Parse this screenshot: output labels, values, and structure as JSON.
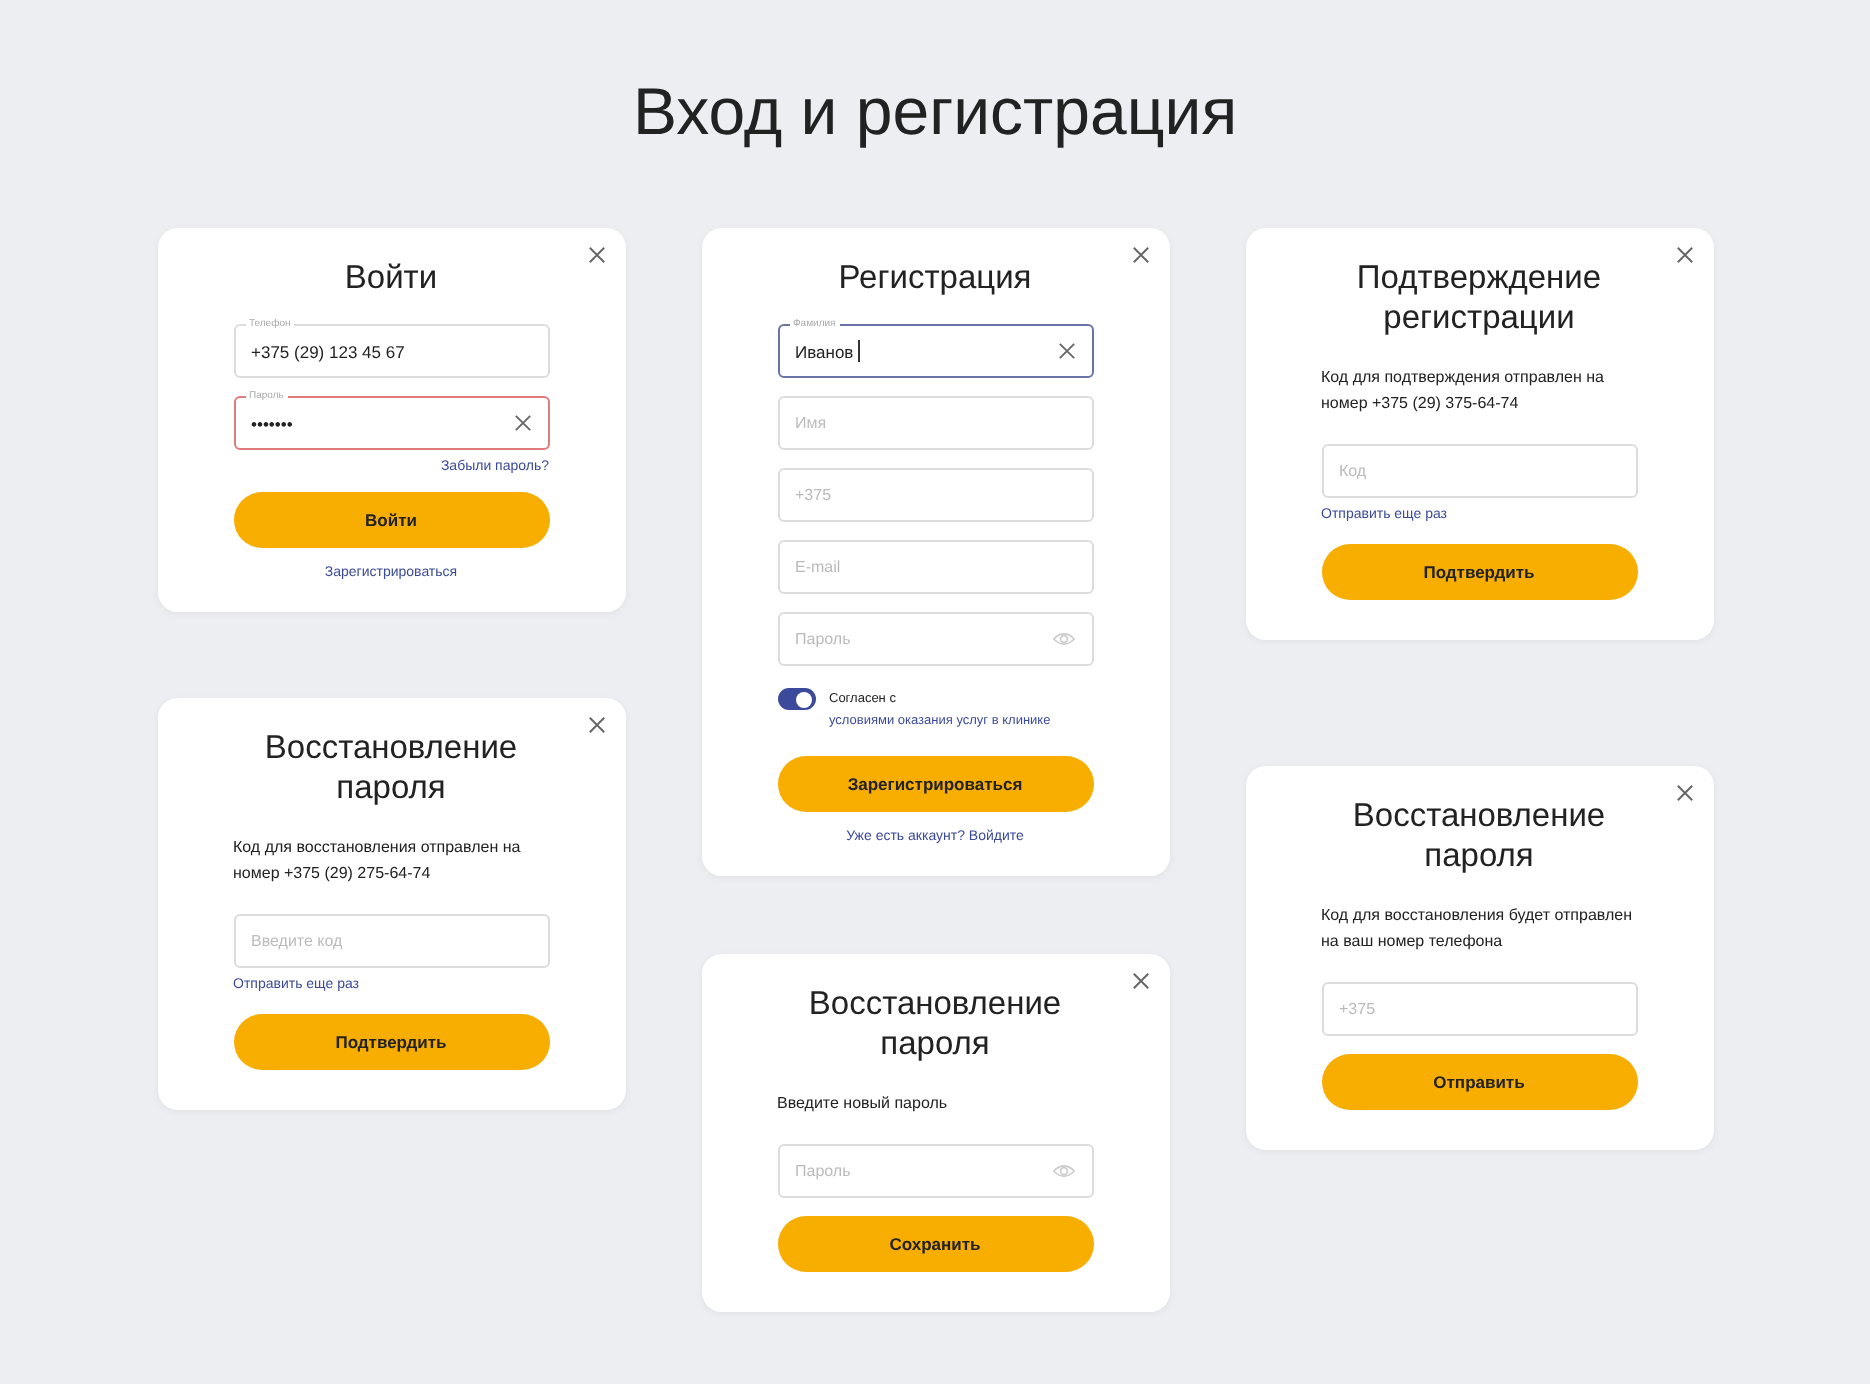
{
  "title": "Вход и регистрация",
  "columns": [
    [
      {
        "items": [
          {
            "kind": "title",
            "text": "Войти"
          },
          {
            "kind": "field",
            "label": "Телефон",
            "value": "+375 (29) 123 45 67",
            "error": false,
            "focused": false
          },
          {
            "kind": "field",
            "label": "Пароль",
            "value": "•••••••",
            "error": true,
            "focused": false,
            "clearable": true
          },
          {
            "kind": "hint",
            "text": "Забыли пароль?"
          },
          {
            "kind": "button",
            "text": "Войти"
          },
          {
            "kind": "footer",
            "text": "Зарегистрироваться"
          }
        ]
      },
      {
        "items": [
          {
            "kind": "title",
            "text": "Восстановление пароля"
          },
          {
            "kind": "text",
            "text": "Код для восстановления отправлен на номер +375 (29) 275-64-74"
          },
          {
            "kind": "field",
            "placeholder": "Введите код",
            "error": false,
            "focused": false
          },
          {
            "kind": "resend",
            "text": "Отправить еще раз"
          },
          {
            "kind": "button",
            "text": "Подтвердить"
          }
        ]
      }
    ],
    [
      {
        "items": [
          {
            "kind": "title",
            "text": "Регистрация"
          },
          {
            "kind": "field",
            "label": "Фамилия",
            "value": "Иванов",
            "error": false,
            "focused": true,
            "clearable": true
          },
          {
            "kind": "field",
            "placeholder": "Имя",
            "error": false,
            "focused": false
          },
          {
            "kind": "field",
            "placeholder": "+375",
            "error": false,
            "focused": false
          },
          {
            "kind": "field",
            "placeholder": "E-mail",
            "error": false,
            "focused": false
          },
          {
            "kind": "field",
            "placeholder": "Пароль",
            "error": false,
            "focused": false,
            "revealable": true
          },
          {
            "kind": "toggle",
            "on": true,
            "text": "Согласен с ",
            "link": "условиями оказания услуг в клинике"
          },
          {
            "kind": "button",
            "text": "Зарегистрироваться"
          },
          {
            "kind": "footer",
            "text": "Уже есть аккаунт? Войдите"
          }
        ]
      },
      {
        "items": [
          {
            "kind": "title",
            "text": "Восстановление пароля"
          },
          {
            "kind": "text",
            "text": "Введите новый пароль"
          },
          {
            "kind": "field",
            "placeholder": "Пароль",
            "error": false,
            "focused": false,
            "revealable": true
          },
          {
            "kind": "button",
            "text": "Сохранить"
          }
        ]
      }
    ],
    [
      {
        "items": [
          {
            "kind": "title",
            "text": "Подтверждение регистрации"
          },
          {
            "kind": "text",
            "text": "Код для подтверждения отправлен на номер +375 (29) 375-64-74"
          },
          {
            "kind": "field",
            "placeholder": "Код",
            "error": false,
            "focused": false
          },
          {
            "kind": "resend",
            "text": "Отправить еще раз"
          },
          {
            "kind": "button",
            "text": "Подтвердить"
          }
        ]
      },
      {
        "items": [
          {
            "kind": "title",
            "text": "Восстановление пароля"
          },
          {
            "kind": "text",
            "text": "Код для восстановления будет отправлен на ваш номер телефона"
          },
          {
            "kind": "field",
            "placeholder": "+375",
            "error": false,
            "focused": false
          },
          {
            "kind": "button",
            "text": "Отправить"
          }
        ]
      }
    ]
  ]
}
